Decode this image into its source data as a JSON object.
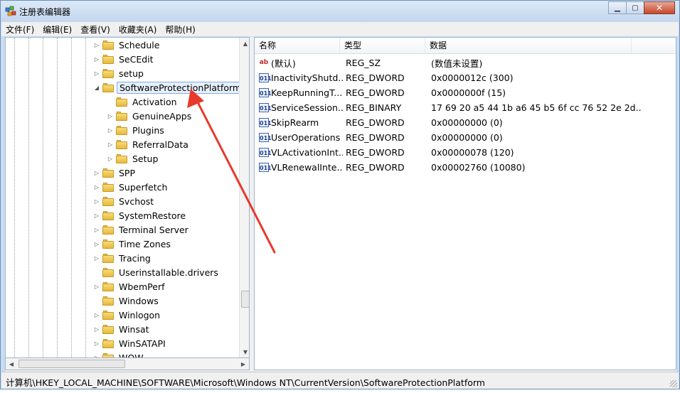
{
  "window": {
    "title": "注册表编辑器"
  },
  "menu": [
    "文件(F)",
    "编辑(E)",
    "查看(V)",
    "收藏夹(A)",
    "帮助(H)"
  ],
  "tree": {
    "items": [
      {
        "label": "Schedule",
        "level": 1,
        "expander": "▷"
      },
      {
        "label": "SeCEdit",
        "level": 1,
        "expander": "▷"
      },
      {
        "label": "setup",
        "level": 1,
        "expander": "▷"
      },
      {
        "label": "SoftwareProtectionPlatform",
        "level": 1,
        "expander": "◢",
        "selected": true
      },
      {
        "label": "Activation",
        "level": 2,
        "expander": ""
      },
      {
        "label": "GenuineApps",
        "level": 2,
        "expander": "▷"
      },
      {
        "label": "Plugins",
        "level": 2,
        "expander": "▷"
      },
      {
        "label": "ReferralData",
        "level": 2,
        "expander": "▷"
      },
      {
        "label": "Setup",
        "level": 2,
        "expander": "▷"
      },
      {
        "label": "SPP",
        "level": 1,
        "expander": "▷"
      },
      {
        "label": "Superfetch",
        "level": 1,
        "expander": "▷"
      },
      {
        "label": "Svchost",
        "level": 1,
        "expander": "▷"
      },
      {
        "label": "SystemRestore",
        "level": 1,
        "expander": "▷"
      },
      {
        "label": "Terminal Server",
        "level": 1,
        "expander": "▷"
      },
      {
        "label": "Time Zones",
        "level": 1,
        "expander": "▷"
      },
      {
        "label": "Tracing",
        "level": 1,
        "expander": "▷"
      },
      {
        "label": "Userinstallable.drivers",
        "level": 1,
        "expander": ""
      },
      {
        "label": "WbemPerf",
        "level": 1,
        "expander": "▷"
      },
      {
        "label": "Windows",
        "level": 1,
        "expander": ""
      },
      {
        "label": "Winlogon",
        "level": 1,
        "expander": "▷"
      },
      {
        "label": "Winsat",
        "level": 1,
        "expander": "▷"
      },
      {
        "label": "WinSATAPI",
        "level": 1,
        "expander": "▷"
      },
      {
        "label": "WOW",
        "level": 1,
        "expander": "▷"
      }
    ]
  },
  "list": {
    "columns": [
      "名称",
      "类型",
      "数据"
    ],
    "rows": [
      {
        "icon": "string-value-icon",
        "name": "(默认)",
        "type": "REG_SZ",
        "data": "(数值未设置)"
      },
      {
        "icon": "binary-value-icon",
        "name": "InactivityShutd...",
        "type": "REG_DWORD",
        "data": "0x0000012c (300)"
      },
      {
        "icon": "binary-value-icon",
        "name": "KeepRunningT...",
        "type": "REG_DWORD",
        "data": "0x0000000f (15)"
      },
      {
        "icon": "binary-value-icon",
        "name": "ServiceSession...",
        "type": "REG_BINARY",
        "data": "17 69 20 a5 44 1b a6 45 b5 6f cc 76 52 2e 2d..."
      },
      {
        "icon": "binary-value-icon",
        "name": "SkipRearm",
        "type": "REG_DWORD",
        "data": "0x00000000 (0)"
      },
      {
        "icon": "binary-value-icon",
        "name": "UserOperations",
        "type": "REG_DWORD",
        "data": "0x00000000 (0)"
      },
      {
        "icon": "binary-value-icon",
        "name": "VLActivationInt...",
        "type": "REG_DWORD",
        "data": "0x00000078 (120)"
      },
      {
        "icon": "binary-value-icon",
        "name": "VLRenewalInte...",
        "type": "REG_DWORD",
        "data": "0x00002760 (10080)"
      }
    ]
  },
  "statusbar": {
    "path": "计算机\\HKEY_LOCAL_MACHINE\\SOFTWARE\\Microsoft\\Windows NT\\CurrentVersion\\SoftwareProtectionPlatform"
  },
  "annotation": {
    "color": "#e8392b"
  }
}
